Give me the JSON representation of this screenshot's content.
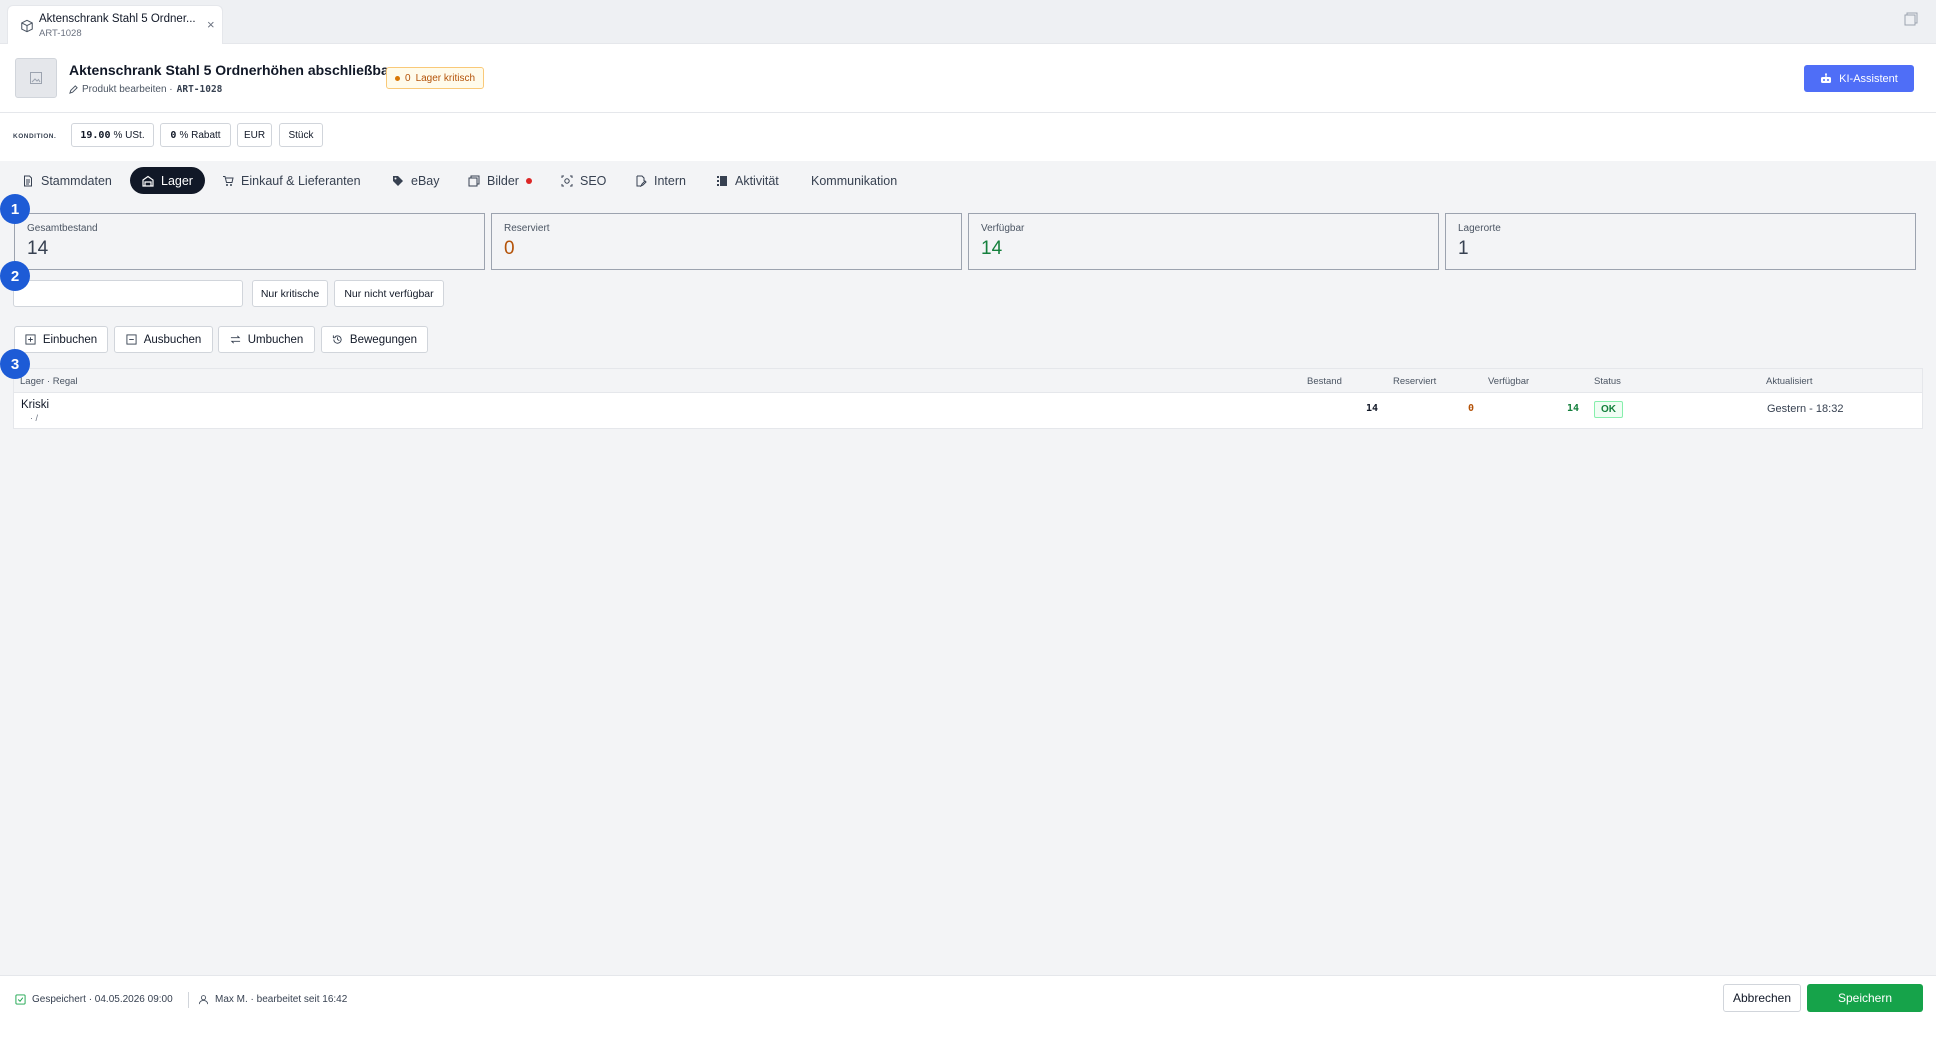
{
  "doc_tab": {
    "title": "Aktenschrank Stahl 5 Ordner...",
    "sku": "ART-1028",
    "close": "×"
  },
  "header": {
    "title": "Aktenschrank Stahl 5 Ordnerhöhen abschließbar",
    "edit_label": "Produkt bearbeiten ·",
    "sku": "ART-1028",
    "badge_count": "0",
    "badge_text": "Lager kritisch",
    "ki_button": "KI-Assistent"
  },
  "conditions": {
    "label": "KONDITION.",
    "vat_value": "19.00",
    "vat_unit": "% USt.",
    "discount_value": "0",
    "discount_unit": "% Rabatt",
    "currency": "EUR",
    "unit": "Stück"
  },
  "tabs": [
    "Stammdaten",
    "Lager",
    "Einkauf & Lieferanten",
    "eBay",
    "Bilder",
    "SEO",
    "Intern",
    "Aktivität",
    "Kommunikation"
  ],
  "steps": [
    "1",
    "2",
    "3"
  ],
  "stats": [
    {
      "label": "Gesamtbestand",
      "value": "14",
      "color": "#374151"
    },
    {
      "label": "Reserviert",
      "value": "0",
      "color": "#b45309"
    },
    {
      "label": "Verfügbar",
      "value": "14",
      "color": "#15803d"
    },
    {
      "label": "Lagerorte",
      "value": "1",
      "color": "#374151"
    }
  ],
  "filters": {
    "search_placeholder": "",
    "critical": "Nur kritische",
    "unavailable": "Nur nicht verfügbar"
  },
  "actions": [
    "Einbuchen",
    "Ausbuchen",
    "Umbuchen",
    "Bewegungen"
  ],
  "table": {
    "headers": {
      "location": "Lager · Regal",
      "stock": "Bestand",
      "reserved": "Reserviert",
      "available": "Verfügbar",
      "status": "Status",
      "updated": "Aktualisiert"
    },
    "rows": [
      {
        "location": "Kriski",
        "sub": "·     /",
        "stock": "14",
        "reserved": "0",
        "available": "14",
        "status": "OK",
        "updated": "Gestern - 18:32"
      }
    ]
  },
  "footer": {
    "saved": "Gespeichert · 04.05.2026 09:00",
    "editor": "Max M. · bearbeitet seit 16:42",
    "cancel": "Abbrechen",
    "save": "Speichern"
  },
  "colors": {
    "accent": "#4f6ef7",
    "active_tab": "#111827",
    "save": "#16a34a",
    "step": "#1d5bd6",
    "critical": "#d97706"
  }
}
